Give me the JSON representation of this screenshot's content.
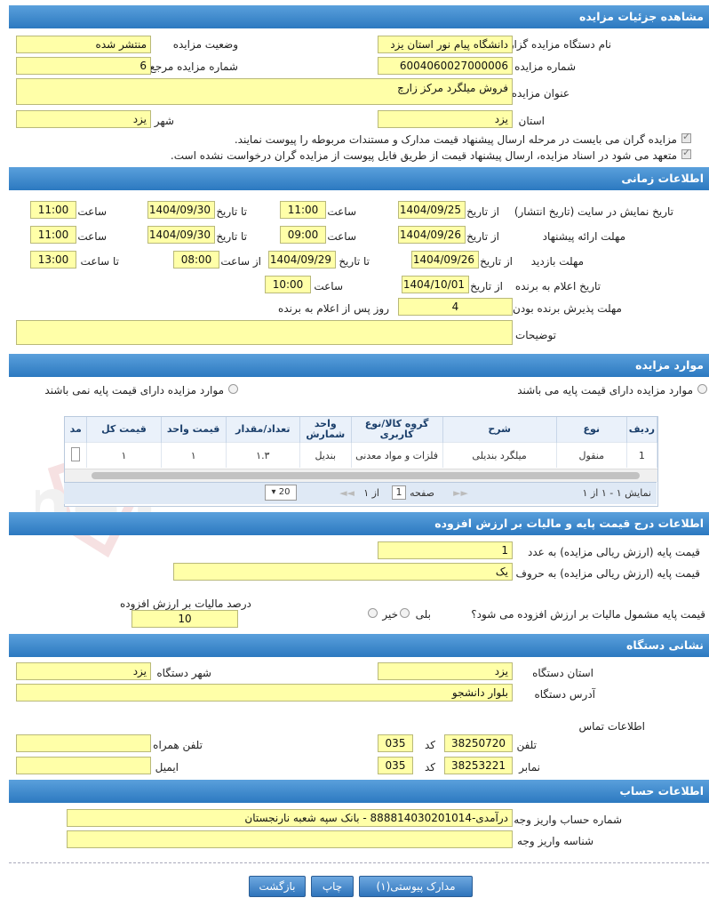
{
  "sections": {
    "details": "مشاهده جزئیات مزایده",
    "timing": "اطلاعات زمانی",
    "items": "موارد مزایده",
    "price": "اطلاعات درج قیمت پایه و مالیات بر ارزش افزوده",
    "address": "نشانی دستگاه",
    "account": "اطلاعات حساب"
  },
  "details": {
    "org_label": "نام دستگاه مزایده گزار",
    "org_value": "دانشگاه پیام نور استان یزد",
    "status_label": "وضعیت مزایده",
    "status_value": "منتشر شده",
    "number_label": "شماره مزایده",
    "number_value": "6004060027000006",
    "ref_label": "شماره مزایده مرجع",
    "ref_value": "6",
    "subject_label": "عنوان مزایده",
    "subject_value": "فروش میلگرد مرکز زارچ",
    "province_label": "استان",
    "province_value": "یزد",
    "city_label": "شهر",
    "city_value": "یزد",
    "note1": "مزایده گران می بایست در مرحله ارسال پیشنهاد قیمت مدارک و مستندات مربوطه را پیوست نمایند.",
    "note2": "متعهد می شود در اسناد مزایده، ارسال پیشنهاد قیمت از طریق فایل پیوست از مزایده گران درخواست نشده است."
  },
  "timing": {
    "publish_label": "تاریخ نمایش در سایت (تاریخ انتشار)",
    "submit_label": "مهلت ارائه پیشنهاد",
    "visit_label": "مهلت بازدید",
    "announce_label": "تاریخ اعلام به برنده",
    "accept_label": "مهلت پذیرش برنده بودن",
    "desc_label": "توضیحات",
    "from_date": "از تاریخ",
    "to_date": "تا تاریخ",
    "time": "ساعت",
    "from_time": "از ساعت",
    "to_time": "تا ساعت",
    "days_after": "روز پس از اعلام به برنده",
    "publish_from": "1404/09/25",
    "publish_from_time": "11:00",
    "publish_to": "1404/09/30",
    "publish_to_time": "11:00",
    "submit_from": "1404/09/26",
    "submit_from_time": "09:00",
    "submit_to": "1404/09/30",
    "submit_to_time": "11:00",
    "visit_from": "1404/09/26",
    "visit_to": "1404/09/29",
    "visit_from_time": "08:00",
    "visit_to_time": "13:00",
    "announce_date": "1404/10/01",
    "announce_time": "10:00",
    "accept_days": "4",
    "desc_value": ""
  },
  "items": {
    "radio_with_base": "موارد مزایده دارای قیمت پایه می باشند",
    "radio_without_base": "موارد مزایده دارای قیمت پایه نمی باشند",
    "columns": [
      "ردیف",
      "نوع",
      "شرح",
      "گروه کالا/نوع کاربری",
      "واحد شمارش",
      "تعداد/مقدار",
      "قیمت واحد",
      "قیمت کل",
      "مد"
    ],
    "rows": [
      [
        "1",
        "منقول",
        "میلگرد بندیلی",
        "فلزات و مواد معدنی",
        "بندیل",
        "۱.۳",
        "۱",
        "۱",
        ""
      ]
    ],
    "pager_summary": "نمایش ۱ - ۱ از ۱",
    "pager_page": "صفحه",
    "pager_page_value": "1",
    "pager_of": "از ۱",
    "pager_size": "20"
  },
  "price": {
    "base_num_label": "قیمت پایه (ارزش ریالی مزایده) به عدد",
    "base_num_value": "1",
    "base_txt_label": "قیمت پایه (ارزش ریالی مزایده) به حروف",
    "base_txt_value": "یک",
    "vat_question": "قیمت پایه مشمول مالیات بر ارزش افزوده می شود؟",
    "yes": "بلی",
    "no": "خیر",
    "vat_pct_label": "درصد مالیات بر ارزش افزوده",
    "vat_pct_value": "10"
  },
  "address": {
    "province_label": "استان دستگاه",
    "province_value": "یزد",
    "city_label": "شهر دستگاه",
    "city_value": "یزد",
    "addr_label": "آدرس دستگاه",
    "addr_value": "بلوار دانشجو",
    "contact_label": "اطلاعات تماس",
    "phone_label": "تلفن",
    "phone_value": "38250720",
    "code_label": "کد",
    "phone_code": "035",
    "mobile_label": "تلفن همراه",
    "mobile_value": "",
    "fax_label": "نمابر",
    "fax_value": "38253221",
    "fax_code": "035",
    "email_label": "ایمیل",
    "email_value": ""
  },
  "account": {
    "acc_label": "شماره حساب واریز وجه",
    "acc_value": "درآمدی-888814030201014 - بانک سپه شعبه نارنجستان",
    "id_label": "شناسه واریز وجه",
    "id_value": ""
  },
  "buttons": {
    "attachments": "مدارک پیوستی(۱)",
    "print": "چاپ",
    "back": "بازگشت"
  },
  "watermark": "AriaTender.neT"
}
